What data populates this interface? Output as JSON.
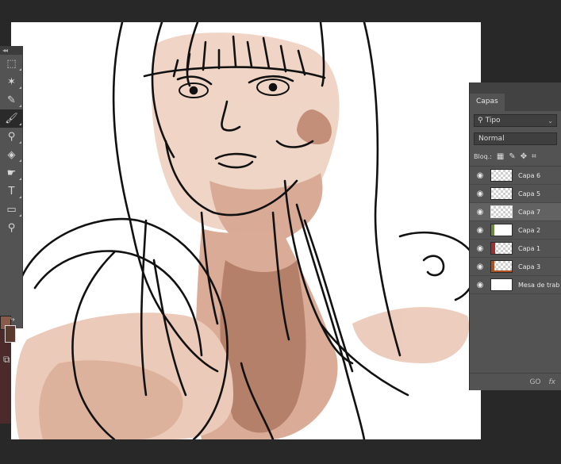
{
  "toolbar": {
    "grip": "◂◂",
    "tools": [
      {
        "name": "marquee-tool",
        "icon": "marquee-icon"
      },
      {
        "name": "magic-wand-tool",
        "icon": "magic-wand-icon"
      },
      {
        "name": "eyedropper-tool",
        "icon": "eyedropper-icon"
      },
      {
        "name": "brush-tool",
        "icon": "brush-icon"
      },
      {
        "name": "clone-stamp-tool",
        "icon": "clone-stamp-icon"
      },
      {
        "name": "paint-bucket-tool",
        "icon": "paint-bucket-icon"
      },
      {
        "name": "smudge-tool",
        "icon": "smudge-icon"
      },
      {
        "name": "type-tool",
        "icon": "type-icon",
        "glyph": "T"
      },
      {
        "name": "rectangle-tool",
        "icon": "rectangle-icon"
      },
      {
        "name": "zoom-tool",
        "icon": "zoom-icon"
      }
    ],
    "foreground_color": "#8a5a4a",
    "background_color": "#5a3a2e"
  },
  "layers_panel": {
    "tab_label": "Capas",
    "filter_label": "Tipo",
    "blend_mode": "Normal",
    "lock_label": "Bloq.:",
    "layers": [
      {
        "name": "Capa 6",
        "thumb": "transparent",
        "active": false
      },
      {
        "name": "Capa 5",
        "thumb": "transparent",
        "active": false
      },
      {
        "name": "Capa 7",
        "thumb": "transparent",
        "active": true
      },
      {
        "name": "Capa 2",
        "thumb": "transparent",
        "active": false
      },
      {
        "name": "Capa 1",
        "thumb": "transparent",
        "active": false
      },
      {
        "name": "Capa 3",
        "thumb": "transparent",
        "active": false
      },
      {
        "name": "Mesa de trab",
        "thumb": "white",
        "active": false
      }
    ],
    "footer_link": "GO",
    "footer_fx": "fx"
  },
  "colors": {
    "panel_bg": "#535353",
    "skin_light": "#ecd0c0",
    "skin_mid": "#d9a892",
    "skin_dark": "#8c5a44",
    "ink": "#111111"
  }
}
